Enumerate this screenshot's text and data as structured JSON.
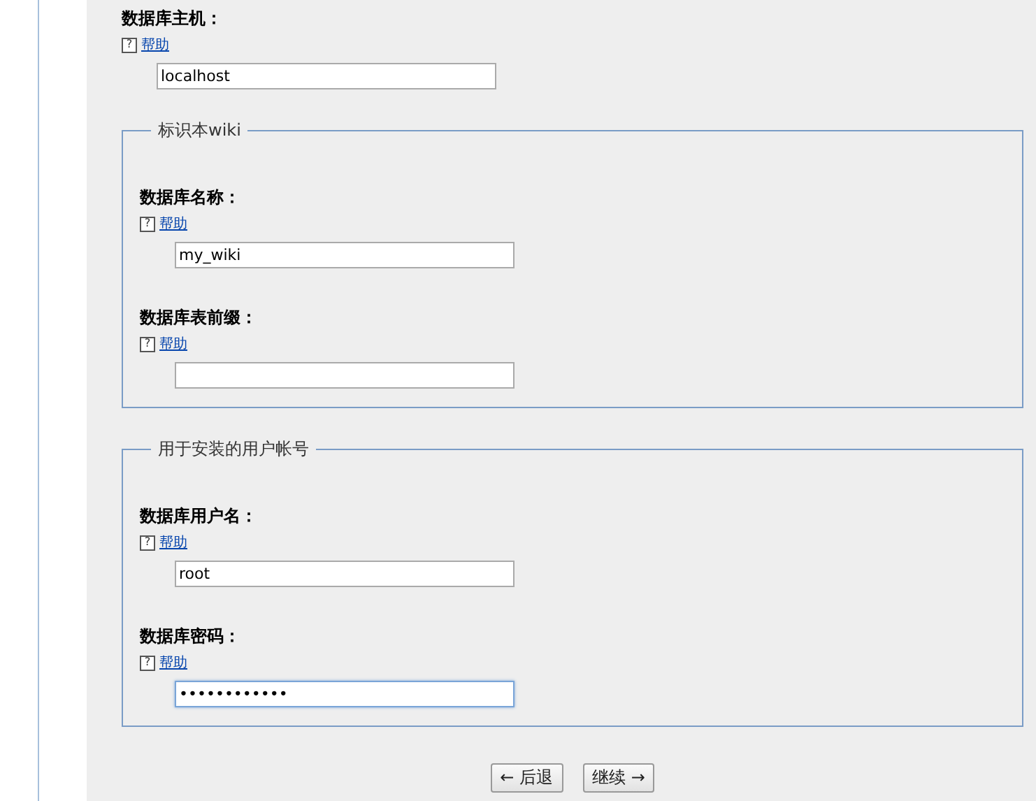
{
  "host_field": {
    "label": "数据库主机：",
    "help": "帮助",
    "help_icon": "?",
    "value": "localhost",
    "focused": false
  },
  "fieldsets": [
    {
      "legend": "标识本wiki",
      "fields": [
        {
          "label": "数据库名称：",
          "help": "帮助",
          "help_icon": "?",
          "value": "my_wiki",
          "focused": false
        },
        {
          "label": "数据库表前缀：",
          "help": "帮助",
          "help_icon": "?",
          "focused": false
        }
      ]
    },
    {
      "legend": "用于安装的用户帐号",
      "fields": [
        {
          "label": "数据库用户名：",
          "help": "帮助",
          "help_icon": "?",
          "value": "root",
          "focused": false
        },
        {
          "label": "数据库密码：",
          "help": "帮助",
          "help_icon": "?",
          "value": "••••••••••••",
          "focused": true
        }
      ]
    }
  ],
  "buttons": [
    "← 后退",
    "继续 →"
  ]
}
